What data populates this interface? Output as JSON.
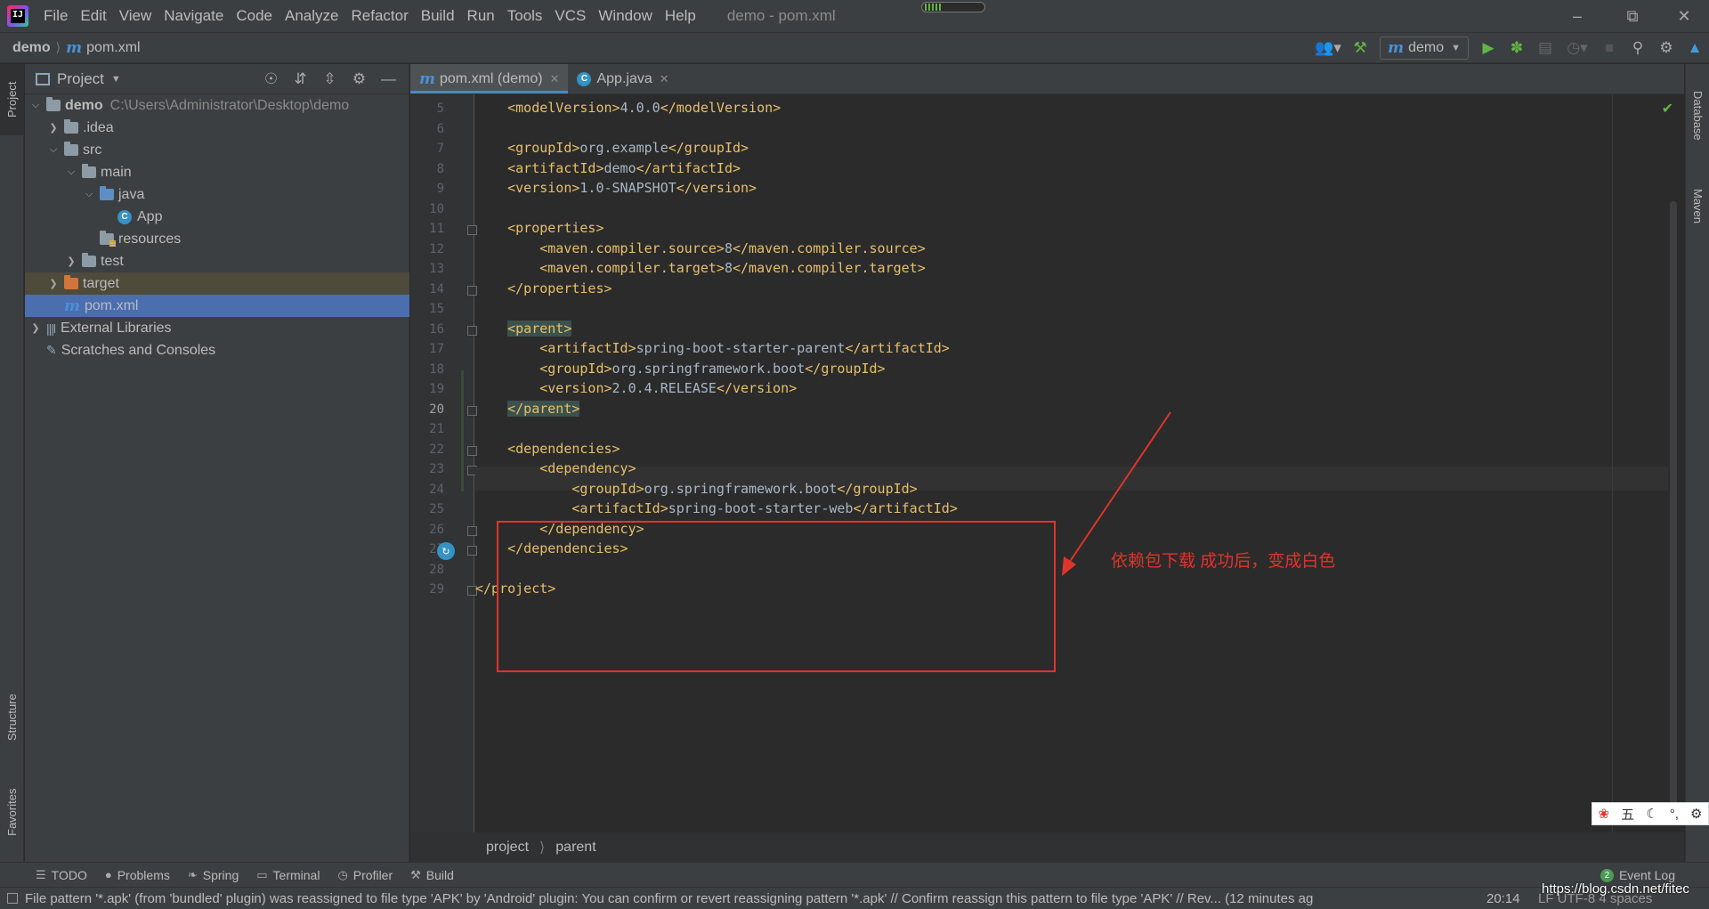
{
  "menu": {
    "items": [
      "File",
      "Edit",
      "View",
      "Navigate",
      "Code",
      "Analyze",
      "Refactor",
      "Build",
      "Run",
      "Tools",
      "VCS",
      "Window",
      "Help"
    ],
    "window_title": "demo - pom.xml"
  },
  "navbar": {
    "project": "demo",
    "file": "pom.xml",
    "run_config": "demo"
  },
  "project_panel": {
    "title": "Project",
    "tree": [
      {
        "label": "demo",
        "path": "C:\\Users\\Administrator\\Desktop\\demo"
      },
      {
        "label": ".idea"
      },
      {
        "label": "src"
      },
      {
        "label": "main"
      },
      {
        "label": "java"
      },
      {
        "label": "App"
      },
      {
        "label": "resources"
      },
      {
        "label": "test"
      },
      {
        "label": "target"
      },
      {
        "label": "pom.xml"
      },
      {
        "label": "External Libraries"
      },
      {
        "label": "Scratches and Consoles"
      }
    ]
  },
  "left_stripe": {
    "project": "Project",
    "structure": "Structure",
    "favorites": "Favorites"
  },
  "right_stripe": {
    "database": "Database",
    "maven": "Maven"
  },
  "editor_tabs": [
    {
      "label": "pom.xml (demo)",
      "active": true
    },
    {
      "label": "App.java",
      "active": false
    }
  ],
  "editor": {
    "current_line": 20,
    "lines": [
      {
        "n": "5",
        "text": "    <modelVersion>4.0.0</modelVersion>"
      },
      {
        "n": "6",
        "text": ""
      },
      {
        "n": "7",
        "text": "    <groupId>org.example</groupId>"
      },
      {
        "n": "8",
        "text": "    <artifactId>demo</artifactId>"
      },
      {
        "n": "9",
        "text": "    <version>1.0-SNAPSHOT</version>"
      },
      {
        "n": "10",
        "text": ""
      },
      {
        "n": "11",
        "text": "    <properties>"
      },
      {
        "n": "12",
        "text": "        <maven.compiler.source>8</maven.compiler.source>"
      },
      {
        "n": "13",
        "text": "        <maven.compiler.target>8</maven.compiler.target>"
      },
      {
        "n": "14",
        "text": "    </properties>"
      },
      {
        "n": "15",
        "text": ""
      },
      {
        "n": "16",
        "text": "    <parent>"
      },
      {
        "n": "17",
        "text": "        <artifactId>spring-boot-starter-parent</artifactId>"
      },
      {
        "n": "18",
        "text": "        <groupId>org.springframework.boot</groupId>"
      },
      {
        "n": "19",
        "text": "        <version>2.0.4.RELEASE</version>"
      },
      {
        "n": "20",
        "text": "    </parent>"
      },
      {
        "n": "21",
        "text": ""
      },
      {
        "n": "22",
        "text": "    <dependencies>"
      },
      {
        "n": "23",
        "text": "        <dependency>"
      },
      {
        "n": "24",
        "text": "            <groupId>org.springframework.boot</groupId>"
      },
      {
        "n": "25",
        "text": "            <artifactId>spring-boot-starter-web</artifactId>"
      },
      {
        "n": "26",
        "text": "        </dependency>"
      },
      {
        "n": "27",
        "text": "    </dependencies>"
      },
      {
        "n": "28",
        "text": ""
      },
      {
        "n": "29",
        "text": "</project>"
      }
    ],
    "breadcrumb": [
      "project",
      "parent"
    ]
  },
  "annotation": {
    "text": "依赖包下载 成功后，变成白色",
    "color": "#e0342b"
  },
  "bottom_tools": [
    "TODO",
    "Problems",
    "Spring",
    "Terminal",
    "Profiler",
    "Build"
  ],
  "event_log": {
    "label": "Event Log",
    "count": "2"
  },
  "statusbar": {
    "message": "File pattern '*.apk' (from 'bundled' plugin) was reassigned to file type 'APK' by 'Android' plugin: You can confirm or revert reassigning pattern '*.apk' // Confirm reassign this pattern to file type 'APK' // Rev... (12 minutes ag",
    "caret": "20:14",
    "right": "LF  UTF-8  4 spaces"
  },
  "watermark": "https://blog.csdn.net/fitec",
  "ime": {
    "glyph": "五"
  }
}
